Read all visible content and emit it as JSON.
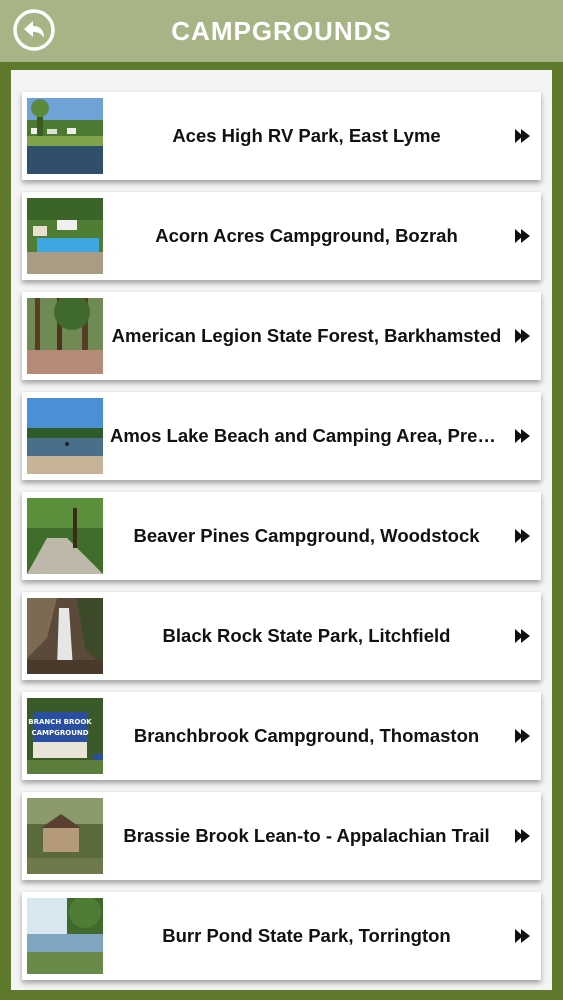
{
  "header": {
    "title": "CAMPGROUNDS",
    "back_icon": "back-arrow-icon",
    "background_color": "#a7b586"
  },
  "list": {
    "items": [
      {
        "label": "Aces High RV Park, East Lyme"
      },
      {
        "label": "Acorn Acres Campground, Bozrah"
      },
      {
        "label": "American Legion State Forest, Barkhamsted"
      },
      {
        "label": "Amos Lake Beach and Camping Area, Preston"
      },
      {
        "label": "Beaver Pines Campground, Woodstock"
      },
      {
        "label": "Black Rock State Park, Litchfield"
      },
      {
        "label": "Branchbrook Campground, Thomaston"
      },
      {
        "label": "Brassie Brook Lean-to - Appalachian Trail"
      },
      {
        "label": "Burr Pond State Park, Torrington"
      }
    ],
    "thumbnail_signs": {
      "branchbrook": "BRANCH BROOK CAMPGROUND"
    },
    "arrow_icon": "play-arrow-icon"
  }
}
